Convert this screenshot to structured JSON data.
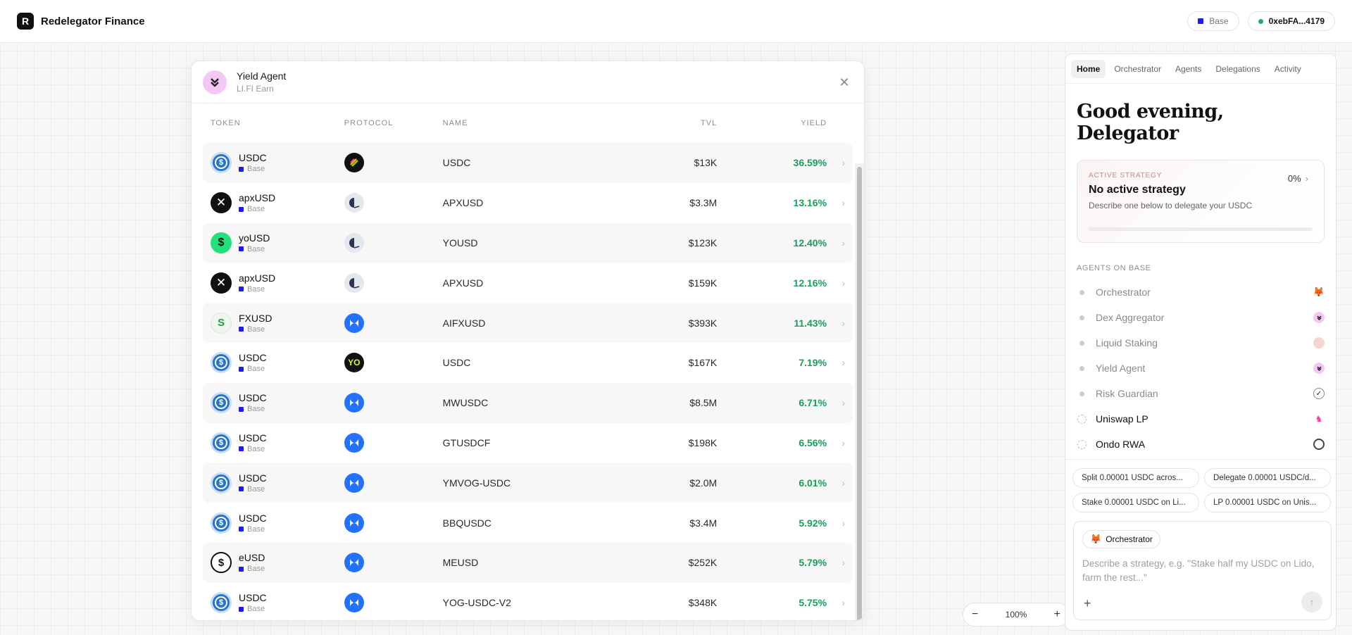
{
  "app": {
    "name": "Redelegator Finance",
    "logo_letter": "R",
    "network_label": "Base",
    "wallet_label": "0xebFA...4179"
  },
  "modal": {
    "title": "Yield Agent",
    "subtitle": "LI.FI Earn",
    "close_glyph": "✕",
    "headers": {
      "token": "TOKEN",
      "protocol": "PROTOCOL",
      "name": "NAME",
      "tvl": "TVL",
      "yield": "YIELD"
    },
    "rows": [
      {
        "token": "USDC",
        "chain": "Base",
        "token_icon": "usdc-icon",
        "protocol_icon": "stack-protocol-icon",
        "name": "USDC",
        "tvl": "$13K",
        "yield": "36.59%"
      },
      {
        "token": "apxUSD",
        "chain": "Base",
        "token_icon": "apx-icon",
        "protocol_icon": "half-circle-protocol-icon",
        "name": "APXUSD",
        "tvl": "$3.3M",
        "yield": "13.16%"
      },
      {
        "token": "yoUSD",
        "chain": "Base",
        "token_icon": "yousd-icon",
        "protocol_icon": "half-circle-protocol-icon",
        "name": "YOUSD",
        "tvl": "$123K",
        "yield": "12.40%"
      },
      {
        "token": "apxUSD",
        "chain": "Base",
        "token_icon": "apx-icon",
        "protocol_icon": "half-circle-protocol-icon",
        "name": "APXUSD",
        "tvl": "$159K",
        "yield": "12.16%"
      },
      {
        "token": "FXUSD",
        "chain": "Base",
        "token_icon": "fxusd-icon",
        "protocol_icon": "morpho-protocol-icon",
        "name": "AIFXUSD",
        "tvl": "$393K",
        "yield": "11.43%"
      },
      {
        "token": "USDC",
        "chain": "Base",
        "token_icon": "usdc-icon",
        "protocol_icon": "yo-protocol-icon",
        "name": "USDC",
        "tvl": "$167K",
        "yield": "7.19%"
      },
      {
        "token": "USDC",
        "chain": "Base",
        "token_icon": "usdc-icon",
        "protocol_icon": "morpho-protocol-icon",
        "name": "MWUSDC",
        "tvl": "$8.5M",
        "yield": "6.71%"
      },
      {
        "token": "USDC",
        "chain": "Base",
        "token_icon": "usdc-icon",
        "protocol_icon": "morpho-protocol-icon",
        "name": "GTUSDCF",
        "tvl": "$198K",
        "yield": "6.56%"
      },
      {
        "token": "USDC",
        "chain": "Base",
        "token_icon": "usdc-icon",
        "protocol_icon": "morpho-protocol-icon",
        "name": "YMVOG-USDC",
        "tvl": "$2.0M",
        "yield": "6.01%"
      },
      {
        "token": "USDC",
        "chain": "Base",
        "token_icon": "usdc-icon",
        "protocol_icon": "morpho-protocol-icon",
        "name": "BBQUSDC",
        "tvl": "$3.4M",
        "yield": "5.92%"
      },
      {
        "token": "eUSD",
        "chain": "Base",
        "token_icon": "eusd-icon",
        "protocol_icon": "morpho-protocol-icon",
        "name": "MEUSD",
        "tvl": "$252K",
        "yield": "5.79%"
      },
      {
        "token": "USDC",
        "chain": "Base",
        "token_icon": "usdc-icon",
        "protocol_icon": "morpho-protocol-icon",
        "name": "YOG-USDC-V2",
        "tvl": "$348K",
        "yield": "5.75%"
      }
    ]
  },
  "zoom": {
    "level": "100%",
    "minus": "−",
    "plus": "+"
  },
  "panel": {
    "tabs": [
      "Home",
      "Orchestrator",
      "Agents",
      "Delegations",
      "Activity"
    ],
    "active_tab": "Home",
    "greeting": "Good evening, Delegator",
    "strategy": {
      "label": "ACTIVE STRATEGY",
      "title": "No active strategy",
      "description": "Describe one below to delegate your USDC",
      "percent": "0%",
      "progress": 0
    },
    "agents_label": "AGENTS ON BASE",
    "agents": [
      {
        "name": "Orchestrator",
        "status": "idle",
        "icon": "fox-icon"
      },
      {
        "name": "Dex Aggregator",
        "status": "idle",
        "icon": "lifi-icon"
      },
      {
        "name": "Liquid Staking",
        "status": "idle",
        "icon": "lido-icon"
      },
      {
        "name": "Yield Agent",
        "status": "idle",
        "icon": "lifi-icon"
      },
      {
        "name": "Risk Guardian",
        "status": "idle",
        "icon": "shield-icon"
      },
      {
        "name": "Uniswap LP",
        "status": "live",
        "icon": "uniswap-icon"
      },
      {
        "name": "Ondo RWA",
        "status": "live",
        "icon": "ondo-icon"
      }
    ],
    "suggestions": [
      "Split 0.00001 USDC acros...",
      "Delegate 0.00001 USDC/d...",
      "Stake 0.00001 USDC on Li...",
      "LP 0.00001 USDC on Unis..."
    ],
    "composer": {
      "agent_chip": "Orchestrator",
      "placeholder": "Describe a strategy, e.g. \"Stake half my USDC on Lido, farm the rest...\"",
      "plus_glyph": "+",
      "send_glyph": "↑"
    }
  },
  "colors": {
    "yield_green": "#16a05a",
    "base_blue": "#1a1aff",
    "wallet_dot": "#17b26a"
  }
}
